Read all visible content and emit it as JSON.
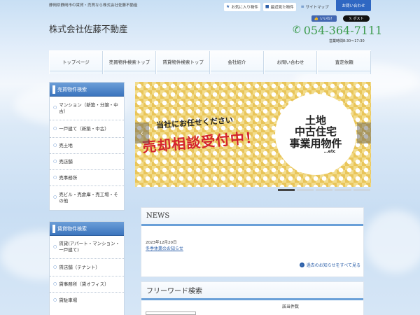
{
  "header": {
    "tagline": "静岡県静岡市の賃貸・売買なら株式会社佐藤不動産",
    "site_title": "株式会社佐藤不動産",
    "top_links": [
      {
        "icon": "star-icon",
        "icon_glyph": "★",
        "label": "お気に入り物件"
      },
      {
        "icon": "history-icon",
        "icon_glyph": "■",
        "label": "最近見た物件"
      },
      {
        "icon": "sitemap-icon",
        "icon_glyph": "≡",
        "label": "サイトマップ"
      }
    ],
    "contact_label": "お問い合わせ",
    "like_label": "いいね！",
    "like_icon": "thumbs-up-icon",
    "post_label": "ポスト",
    "post_icon": "x-logo-icon",
    "phone": "054-364-7111",
    "phone_icon": "phone-icon",
    "hours": "営業時間8:30～17:30"
  },
  "nav": {
    "items": [
      "トップページ",
      "売買物件検索トップ",
      "賃貸物件検索トップ",
      "会社紹介",
      "お問い合わせ",
      "査定依頼"
    ]
  },
  "sidebar": {
    "sale": {
      "title": "売買物件検索",
      "items": [
        "マンション（新築・分譲・中古）",
        "一戸建て（新築・中古）",
        "売土地",
        "売店舗",
        "売事務所",
        "売ビル・売倉庫・売工場・その他"
      ]
    },
    "rent": {
      "title": "賃貸物件検索",
      "items": [
        "賃貸(アパート・マンション・一戸建て)",
        "賃店舗（テナント）",
        "貸事務所（貸オフィス）",
        "貸駐車場"
      ]
    }
  },
  "banner": {
    "tag": "当社にお任せください",
    "headline": "売却相談受付中！",
    "circle_lines": [
      "土地",
      "中古住宅",
      "事業用物件"
    ],
    "etc": "…etc",
    "prev_glyph": "‹",
    "next_glyph": "›",
    "slide_count": 5,
    "active_slide": 1
  },
  "news": {
    "title": "NEWS",
    "date": "2023年12月20日",
    "link": "冬季休業のお知らせ",
    "more": "過去のお知らせをすべて見る",
    "more_icon": "arrow-circle-icon"
  },
  "search": {
    "title": "フリーワード検索",
    "count_label": "該当件数"
  },
  "colors": {
    "accent_blue": "#3b74bd",
    "phone_green": "#3c9b4c",
    "banner_red": "#d4242c",
    "banner_yellow": "#f2dc8c"
  }
}
